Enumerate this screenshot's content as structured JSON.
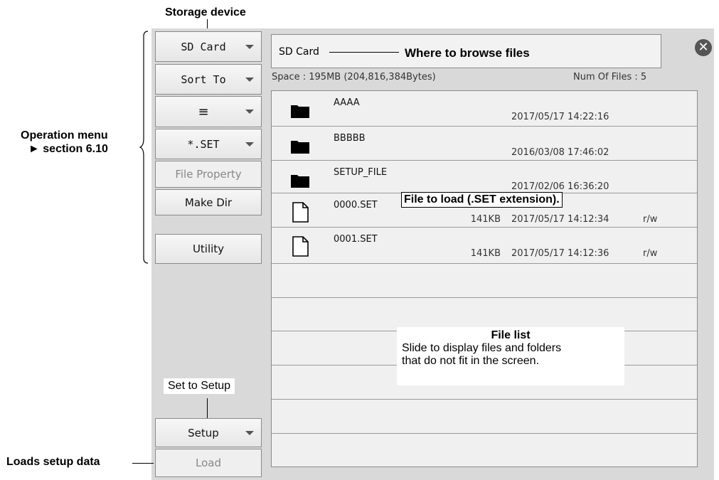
{
  "annotations": {
    "storage_device": "Storage device",
    "where_to_browse": "Where to browse files",
    "operation_menu": "Operation menu",
    "section_ref": "► section 6.10",
    "file_to_load": "File to load (.SET extension).",
    "file_list_title": "File list",
    "file_list_line1": "Slide to display files and folders",
    "file_list_line2": "that do not fit in the screen.",
    "set_to_setup": "Set to Setup",
    "loads_setup_data": "Loads setup data"
  },
  "menu": {
    "storage": "SD Card",
    "sort": "Sort To",
    "view": "≡",
    "filter": "*.SET",
    "file_property": "File Property",
    "make_dir": "Make Dir",
    "utility": "Utility",
    "mode": "Setup",
    "action": "Load"
  },
  "path": {
    "current": "SD Card",
    "space": "Space : 195MB (204,816,384Bytes)",
    "num_files": "Num Of Files : 5"
  },
  "files": [
    {
      "name": "AAAA",
      "size": "",
      "date": "2017/05/17 14:22:16",
      "attr": "",
      "type": "folder"
    },
    {
      "name": "BBBBB",
      "size": "",
      "date": "2016/03/08 17:46:02",
      "attr": "",
      "type": "folder"
    },
    {
      "name": "SETUP_FILE",
      "size": "",
      "date": "2017/02/06 16:36:20",
      "attr": "",
      "type": "folder"
    },
    {
      "name": "0000.SET",
      "size": "141KB",
      "date": "2017/05/17 14:12:34",
      "attr": "r/w",
      "type": "file"
    },
    {
      "name": "0001.SET",
      "size": "141KB",
      "date": "2017/05/17 14:12:36",
      "attr": "r/w",
      "type": "file"
    }
  ],
  "icons": {
    "close": "close-icon",
    "folder": "folder-icon",
    "file": "file-icon",
    "dropdown": "chevron-down-icon"
  }
}
